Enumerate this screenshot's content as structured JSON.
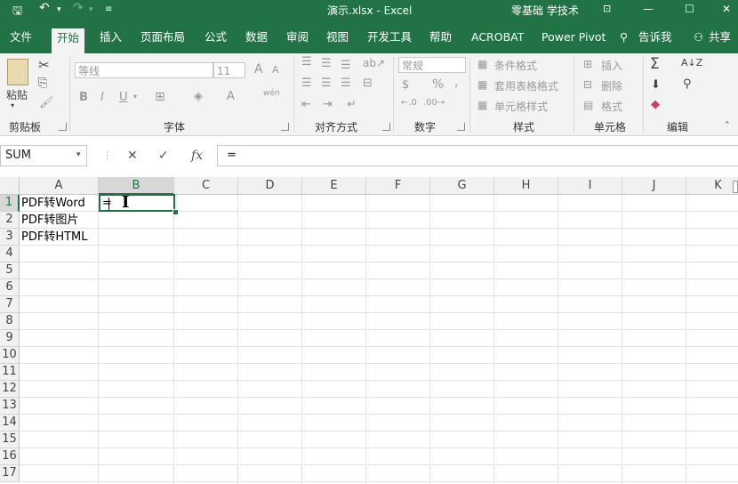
{
  "window": {
    "title": "演示.xlsx  -  Excel",
    "account": "零基础 学技术",
    "controls": [
      "restore",
      "minimize",
      "maximize",
      "close"
    ]
  },
  "tabs": [
    "文件",
    "开始",
    "插入",
    "页面布局",
    "公式",
    "数据",
    "审阅",
    "视图",
    "开发工具",
    "帮助",
    "ACROBAT",
    "Power Pivot"
  ],
  "active_tab": "开始",
  "tell_me": "告诉我",
  "share": "共享",
  "ribbon": {
    "clipboard": {
      "label": "剪贴板",
      "paste": "粘贴"
    },
    "font": {
      "label": "字体",
      "font_name": "等线",
      "font_size": "11",
      "bold": "B",
      "italic": "I",
      "underline": "U",
      "grow": "A",
      "shrink": "A",
      "phonetic": "wén"
    },
    "alignment": {
      "label": "对齐方式"
    },
    "number": {
      "label": "数字",
      "format": "常规",
      "percent": "%",
      "comma": ","
    },
    "styles": {
      "label": "样式",
      "conditional": "条件格式",
      "table": "套用表格格式",
      "cell_styles": "单元格样式"
    },
    "cells": {
      "label": "单元格",
      "insert": "插入",
      "delete": "删除",
      "format": "格式"
    },
    "editing": {
      "label": "编辑"
    }
  },
  "formula_bar": {
    "name_box": "SUM",
    "cancel": "✕",
    "enter": "✓",
    "fx": "fx",
    "content": "="
  },
  "columns": [
    "A",
    "B",
    "C",
    "D",
    "E",
    "F",
    "G",
    "H",
    "I",
    "J",
    "K"
  ],
  "rows": [
    "1",
    "2",
    "3",
    "4",
    "5",
    "6",
    "7",
    "8",
    "9",
    "10",
    "11",
    "12",
    "13",
    "14",
    "15",
    "16",
    "17"
  ],
  "cells": {
    "A1": "PDF转Word",
    "A2": "PDF转图片",
    "A3": "PDF转HTML",
    "B1": "="
  },
  "colors": {
    "accent": "#217346",
    "ribbon_bg": "#f3f3f3"
  }
}
